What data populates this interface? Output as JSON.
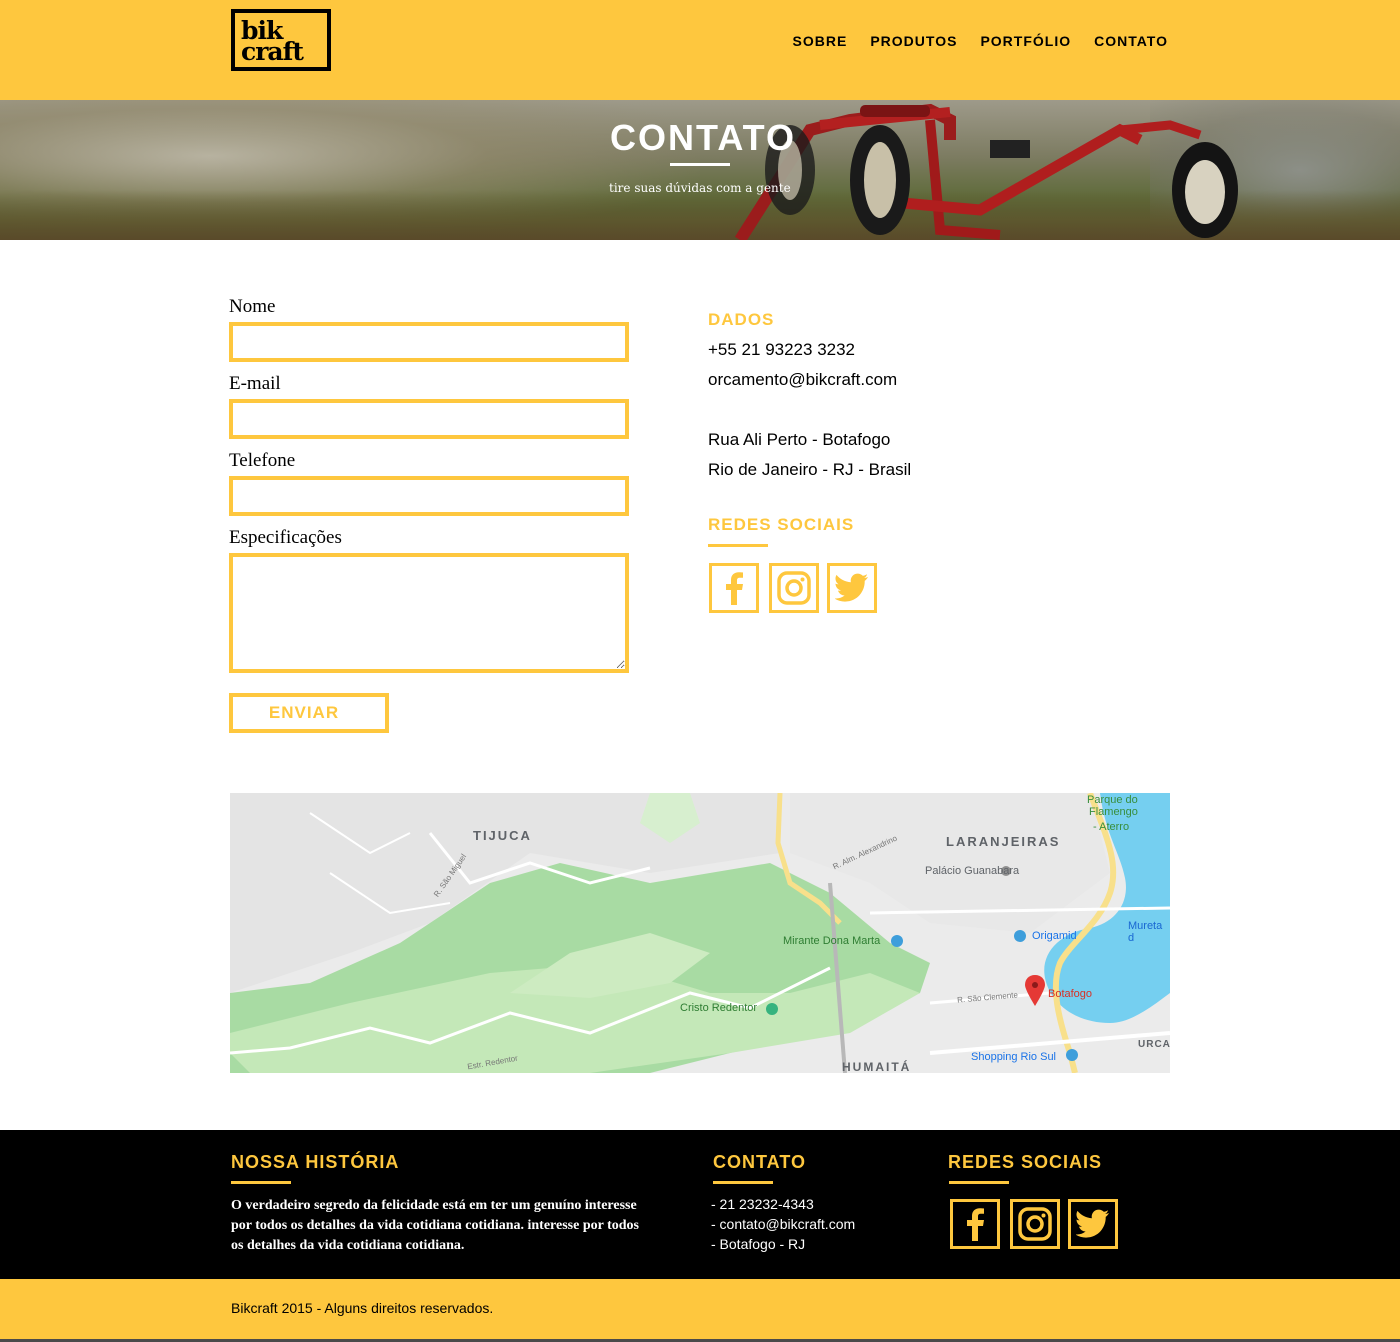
{
  "brand": {
    "logo_line1": "bik",
    "logo_line2": "craft"
  },
  "nav": {
    "items": [
      "SOBRE",
      "PRODUTOS",
      "PORTFÓLIO",
      "CONTATO"
    ]
  },
  "hero": {
    "title": "CONTATO",
    "subtitle": "tire suas dúvidas com a gente"
  },
  "form": {
    "name_label": "Nome",
    "email_label": "E-mail",
    "phone_label": "Telefone",
    "specs_label": "Especificações",
    "send_label": "ENVIAR"
  },
  "dados": {
    "title": "DADOS",
    "phone": "+55 21 93223 3232",
    "email": "orcamento@bikcraft.com",
    "address1": "Rua Ali Perto - Botafogo",
    "address2": "Rio de Janeiro - RJ - Brasil"
  },
  "social": {
    "title": "REDES SOCIAIS",
    "icons": [
      "facebook-icon",
      "instagram-icon",
      "twitter-icon"
    ]
  },
  "map": {
    "labels": {
      "tijuca": "TIJUCA",
      "laranjeiras": "LARANJEIRAS",
      "parque1": "Parque do",
      "parque2": "Flamengo",
      "parque3": "- Aterro",
      "palacio": "Palácio Guanabara",
      "mirante": "Mirante Dona Marta",
      "origamid": "Origamid",
      "mureta": "Mureta d",
      "cristo": "Cristo Redentor",
      "botafogo": "Botafogo",
      "shopping": "Shopping Rio Sul",
      "humaita": "HUMAITÁ",
      "urca": "URCA",
      "r_sao_miguel": "R. São Miguel",
      "r_alm": "R. Alm. Alexandrino",
      "r_sao_clemente": "R. São Clemente",
      "estr_redentor": "Estr. Redentor"
    }
  },
  "footer": {
    "history_title": "NOSSA HISTÓRIA",
    "history_text": "O verdadeiro segredo da felicidade está em ter um genuíno interesse por todos os detalhes da vida cotidiana cotidiana. interesse por todos os detalhes da vida cotidiana cotidiana.",
    "contact_title": "CONTATO",
    "contact_phone": "- 21 23232-4343",
    "contact_email": "- contato@bikcraft.com",
    "contact_place": "- Botafogo - RJ",
    "social_title": "REDES SOCIAIS",
    "copyright": "Bikcraft 2015 - Alguns direitos reservados."
  },
  "colors": {
    "accent": "#FEC73E",
    "dark": "#000000"
  }
}
